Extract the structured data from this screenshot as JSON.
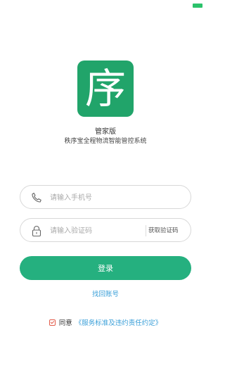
{
  "logo": {
    "char": "序",
    "color": "#21a46a"
  },
  "edition": "管家版",
  "subtitle": "秩序宝全程物流智能管控系统",
  "phone_field": {
    "placeholder": "请输入手机号",
    "value": "",
    "icon": "phone-icon"
  },
  "code_field": {
    "placeholder": "请输入验证码",
    "value": "",
    "icon": "lock-icon",
    "get_code_label": "获取验证码"
  },
  "login_button": {
    "label": "登录",
    "color": "#25b07f"
  },
  "recover_link": "找回账号",
  "agreement": {
    "checked": true,
    "prefix": "同意",
    "link_text": "《服务标准及违约责任约定》"
  },
  "colors": {
    "accent": "#25b07f",
    "link": "#3a9fd8",
    "checkbox": "#e25b4a",
    "battery": "#2bc26b"
  }
}
